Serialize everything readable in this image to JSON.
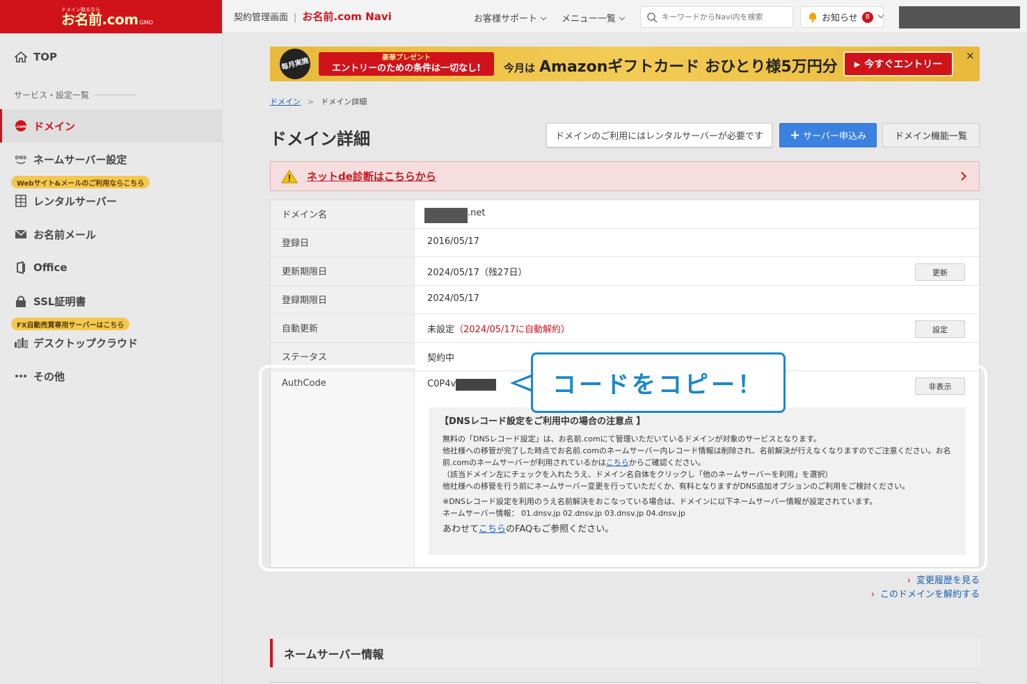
{
  "brand": {
    "tagline": "ドメイン取るなら",
    "logo": "お名前.com",
    "suffix": "GMO"
  },
  "header": {
    "section": "契約管理画面",
    "brand": "お名前.com Navi",
    "support": "お客様サポート",
    "menu": "メニュー一覧",
    "search_placeholder": "キーワードからNavi内を検索",
    "notice": "お知らせ",
    "notice_count": "8"
  },
  "sidebar": {
    "top": "TOP",
    "services_heading": "サービス・設定一覧",
    "items": [
      {
        "label": "ドメイン",
        "icon": ".com"
      },
      {
        "label": "ネームサーバー設定",
        "icon": "DNS"
      },
      {
        "label": "レンタルサーバー",
        "icon": "server-icon"
      },
      {
        "label": "お名前メール",
        "icon": "mail-icon"
      },
      {
        "label": "Office",
        "icon": "office-icon"
      },
      {
        "label": "SSL証明書",
        "icon": "lock-icon"
      },
      {
        "label": "デスクトップクラウド",
        "icon": "chart-icon"
      },
      {
        "label": "その他",
        "icon": "more-icon"
      }
    ],
    "pill_web": "Webサイト&メールのご利用ならこちら",
    "pill_fx": "FX自動売買専用サーバーはこちら"
  },
  "banner": {
    "badge": "毎月実施",
    "ribbon_top": "豪華プレゼント",
    "ribbon_main": "エントリーのための条件は一切なし!",
    "lead": "今月は",
    "headline": "Amazonギフトカード おひとり様5万円分",
    "cta": "今すぐエントリー",
    "close": "×"
  },
  "breadcrumb": {
    "parent": "ドメイン",
    "current": "ドメイン詳細"
  },
  "page": {
    "title": "ドメイン詳細",
    "note_button": "ドメインのご利用にはレンタルサーバーが必要です",
    "server_button": "サーバー申込み",
    "func_button": "ドメイン機能一覧",
    "alert_link": "ネットde診断はこちらから"
  },
  "details": {
    "domain_label": "ドメイン名",
    "domain_value": ".net",
    "reg_label": "登録日",
    "reg_value": "2016/05/17",
    "renew_label": "更新期限日",
    "renew_value": "2024/05/17（残27日）",
    "renew_btn": "更新",
    "regexp_label": "登録期限日",
    "regexp_value": "2024/05/17",
    "auto_label": "自動更新",
    "auto_value": "未設定",
    "auto_note": "（2024/05/17に自動解約）",
    "auto_btn": "設定",
    "status_label": "ステータス",
    "status_value": "契約中",
    "auth_label": "AuthCode",
    "auth_value": "C0P4v",
    "auth_btn": "非表示"
  },
  "dns_note": {
    "title": "【DNSレコード設定をご利用中の場合の注意点 】",
    "p1": "無料の「DNSレコード設定」は、お名前.comにて管理いただいているドメインが対象のサービスとなります。",
    "p2a": "他社様への移管が完了した時点でお名前.comのネームサーバー内レコード情報は削除され、名前解決が行えなくなりますのでご注意ください。お名前.comのネームサーバーが利用されているかは",
    "p2link": "こちら",
    "p2b": "からご確認ください。",
    "p3": "（該当ドメイン左にチェックを入れたうえ、ドメイン名自体をクリックし「他のネームサーバーを利用」を選択）",
    "p4": "他社様への移管を行う前にネームサーバー変更を行っていただくか、有料となりますがDNS追加オプションのご利用をご検討ください。",
    "p5": "※DNSレコード設定を利用のうえ名前解決をおこなっている場合は、ドメインに以下ネームサーバー情報が設定されています。",
    "p6": "ネームサーバー情報： 01.dnsv.jp 02.dnsv.jp 03.dnsv.jp 04.dnsv.jp",
    "faq_a": "あわせて",
    "faq_link": "こちら",
    "faq_b": "のFAQもご参照ください。"
  },
  "callout": "コードをコピー！",
  "links": {
    "history": "変更履歴を見る",
    "cancel": "このドメインを解約する"
  },
  "section_ns": "ネームサーバー情報",
  "colors": {
    "brand_red": "#d0121b",
    "accent_blue": "#1c87c9",
    "link_blue": "#1a5fb4"
  }
}
